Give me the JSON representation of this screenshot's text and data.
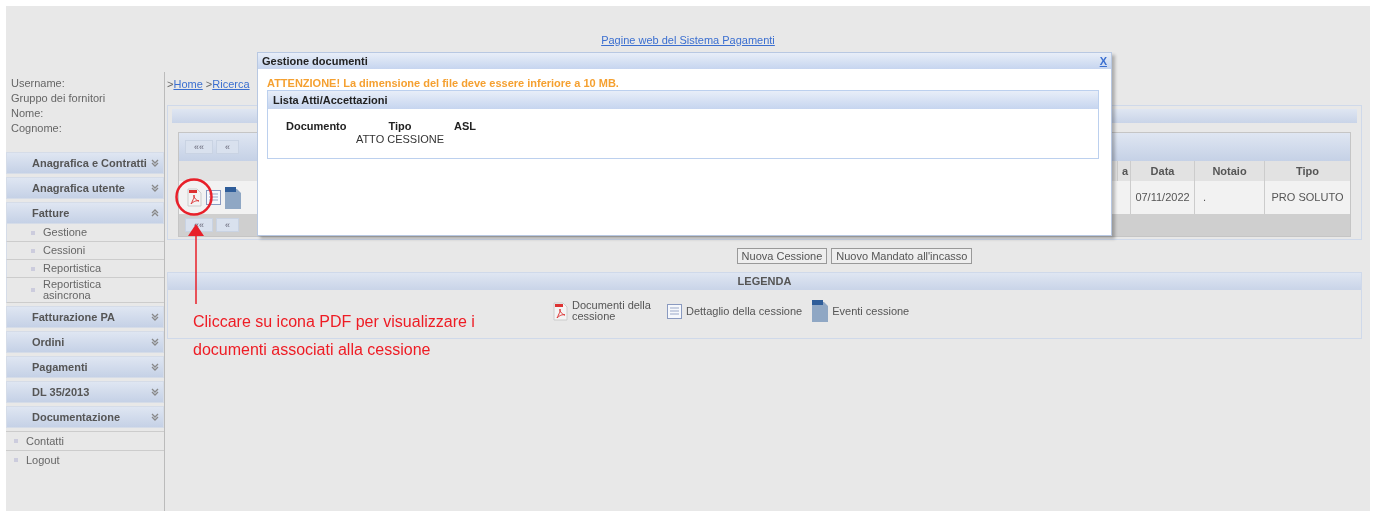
{
  "header_link": "Pagine web del Sistema Pagamenti",
  "user_info": [
    "Username:",
    "Gruppo dei fornitori",
    "Nome:",
    "Cognome:"
  ],
  "menu": [
    {
      "label": "Anagrafica e Contratti",
      "expanded": false
    },
    {
      "label": "Anagrafica utente",
      "expanded": false
    },
    {
      "label": "Fatture",
      "expanded": true,
      "children": [
        {
          "label": "Gestione"
        },
        {
          "label": "Cessioni"
        },
        {
          "label": "Reportistica"
        },
        {
          "label": "Reportistica asincrona"
        }
      ]
    },
    {
      "label": "Fatturazione PA",
      "expanded": false
    },
    {
      "label": "Ordini",
      "expanded": false
    },
    {
      "label": "Pagamenti",
      "expanded": false
    },
    {
      "label": "DL 35/2013",
      "expanded": false
    },
    {
      "label": "Documentazione",
      "expanded": false
    }
  ],
  "links": [
    "Contatti",
    "Logout"
  ],
  "breadcrumb": [
    {
      "separator": ">",
      "label": "Home"
    },
    {
      "separator": ">",
      "label": "Ricerca"
    }
  ],
  "pager": [
    "««",
    "«"
  ],
  "table": {
    "columns": [
      "a",
      "Data",
      "Notaio",
      "Tipo"
    ],
    "rows": [
      {
        "cells": [
          "",
          "07/11/2022",
          ".",
          "PRO SOLUTO"
        ]
      }
    ]
  },
  "buttons": [
    "Nuova Cessione",
    "Nuovo Mandato all'incasso"
  ],
  "legend": {
    "title": "LEGENDA",
    "items": [
      {
        "kind": "pdf",
        "label": "Documenti della cessione"
      },
      {
        "kind": "detail",
        "label": "Dettaglio della cessione"
      },
      {
        "kind": "events",
        "label": "Eventi cessione"
      }
    ]
  },
  "annotation": [
    "Cliccare su icona PDF per visualizzare i",
    "documenti associati alla cessione"
  ],
  "dialog": {
    "title": "Gestione documenti",
    "close": "X",
    "warning": "ATTENZIONE! La dimensione del file deve essere inferiore a 10 MB.",
    "panel": {
      "title": "Lista Atti/Accettazioni",
      "columns": [
        "Documento",
        "Tipo",
        "ASL"
      ],
      "rows": [
        [
          "",
          "ATTO CESSIONE",
          ""
        ]
      ]
    }
  }
}
